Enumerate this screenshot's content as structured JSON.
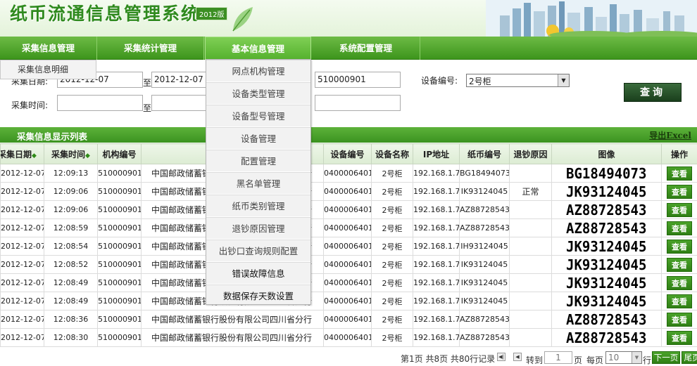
{
  "app": {
    "title": "纸币流通信息管理系统",
    "version": "2012版"
  },
  "nav": [
    {
      "label": "采集信息管理",
      "active": false
    },
    {
      "label": "采集统计管理",
      "active": false
    },
    {
      "label": "基本信息管理",
      "active": true
    },
    {
      "label": "系统配置管理",
      "active": false
    }
  ],
  "submenu": {
    "item": "采集信息明细"
  },
  "filters": {
    "date_label": "采集日期:",
    "date_from": "2012-12-07",
    "date_to": "2012-12-07",
    "to_label": "至",
    "time_label": "采集时间:",
    "time_from": "",
    "time_to": "",
    "org_code": "510000901",
    "org_extra": "",
    "device_label": "设备编号:",
    "device_value": "2号柜",
    "query_button": "查询"
  },
  "list": {
    "title": "采集信息显示列表",
    "export": "导出Excel"
  },
  "columns": [
    "采集日期",
    "采集时间",
    "机构编号",
    "",
    "设备编号",
    "设备名称",
    "IP地址",
    "纸币编号",
    "退钞原因",
    "图像",
    "操作"
  ],
  "rows": [
    {
      "date": "2012-12-07",
      "time": "12:09:13",
      "org": "510000901",
      "bank": "中国邮政储蓄银行股份有限公司四川省分行",
      "device_no": "0400006401",
      "device_name": "2号柜",
      "ip": "192.168.1.7",
      "serial": "BG18494073",
      "reason": "",
      "image": "BG18494073",
      "action": "查看"
    },
    {
      "date": "2012-12-07",
      "time": "12:09:06",
      "org": "510000901",
      "bank": "中国邮政储蓄银行股份有限公司四川省分行",
      "device_no": "0400006401",
      "device_name": "2号柜",
      "ip": "192.168.1.7",
      "serial": "IK93124045",
      "reason": "正常",
      "image": "JK93124045",
      "action": "查看"
    },
    {
      "date": "2012-12-07",
      "time": "12:09:06",
      "org": "510000901",
      "bank": "中国邮政储蓄银行股份有限公司四川省分行",
      "device_no": "0400006401",
      "device_name": "2号柜",
      "ip": "192.168.1.7",
      "serial": "AZ88728543",
      "reason": "",
      "image": "AZ88728543",
      "action": "查看"
    },
    {
      "date": "2012-12-07",
      "time": "12:08:59",
      "org": "510000901",
      "bank": "中国邮政储蓄银行股份有限公司四川省分行",
      "device_no": "0400006401",
      "device_name": "2号柜",
      "ip": "192.168.1.7",
      "serial": "AZ88728543",
      "reason": "",
      "image": "AZ88728543",
      "action": "查看"
    },
    {
      "date": "2012-12-07",
      "time": "12:08:54",
      "org": "510000901",
      "bank": "中国邮政储蓄银行股份有限公司四川省分行",
      "device_no": "0400006401",
      "device_name": "2号柜",
      "ip": "192.168.1.7",
      "serial": "IH93124045",
      "reason": "",
      "image": "JK93124045",
      "action": "查看"
    },
    {
      "date": "2012-12-07",
      "time": "12:08:52",
      "org": "510000901",
      "bank": "中国邮政储蓄银行股份有限公司四川省分行",
      "device_no": "0400006401",
      "device_name": "2号柜",
      "ip": "192.168.1.7",
      "serial": "IK93124045",
      "reason": "",
      "image": "JK93124045",
      "action": "查看"
    },
    {
      "date": "2012-12-07",
      "time": "12:08:49",
      "org": "510000901",
      "bank": "中国邮政储蓄银行股份有限公司四川省分行",
      "device_no": "0400006401",
      "device_name": "2号柜",
      "ip": "192.168.1.7",
      "serial": "IK93124045",
      "reason": "",
      "image": "JK93124045",
      "action": "查看"
    },
    {
      "date": "2012-12-07",
      "time": "12:08:49",
      "org": "510000901",
      "bank": "中国邮政储蓄银行股份有限公司四川省分行",
      "device_no": "0400006401",
      "device_name": "2号柜",
      "ip": "192.168.1.7",
      "serial": "IK93124045",
      "reason": "",
      "image": "JK93124045",
      "action": "查看"
    },
    {
      "date": "2012-12-07",
      "time": "12:08:36",
      "org": "510000901",
      "bank": "中国邮政储蓄银行股份有限公司四川省分行",
      "device_no": "0400006401",
      "device_name": "2号柜",
      "ip": "192.168.1.7",
      "serial": "AZ88728543",
      "reason": "",
      "image": "AZ88728543",
      "action": "查看"
    },
    {
      "date": "2012-12-07",
      "time": "12:08:30",
      "org": "510000901",
      "bank": "中国邮政储蓄银行股份有限公司四川省分行",
      "device_no": "0400006401",
      "device_name": "2号柜",
      "ip": "192.168.1.7",
      "serial": "AZ88728543",
      "reason": "",
      "image": "AZ88728543",
      "action": "查看"
    }
  ],
  "dropdown": [
    "网点机构管理",
    "设备类型管理",
    "设备型号管理",
    "设备管理",
    "配置管理",
    "黑名单管理",
    "纸币类别管理",
    "退钞原因管理",
    "出钞口查询规则配置",
    "错误故障信息",
    "数据保存天数设置"
  ],
  "pager": {
    "info": "第1页 共8页 共80行记录",
    "goto_label": "转到",
    "goto_value": "1",
    "page_label": "页",
    "per_page_label": "每页",
    "per_page_value": "10",
    "rows_label": "行",
    "next": "下一页",
    "last": "尾页"
  },
  "colors": {
    "brand_green": "#3d951c",
    "title_green": "#2f8a1e",
    "header_bg": "#e4f3da"
  },
  "icons": [
    "leaf-icon",
    "city-skyline-icon",
    "sort-icon",
    "first-page-icon",
    "prev-page-icon",
    "dropdown-arrow-icon"
  ]
}
